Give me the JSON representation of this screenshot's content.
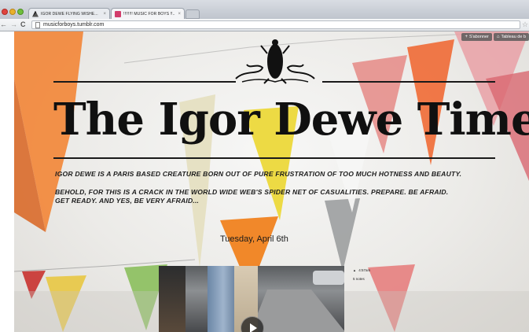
{
  "browser": {
    "tabs": [
      {
        "title": "IGOR DEWE FLYING WISHE...",
        "favicon": "igor-dewe-favicon",
        "active": false
      },
      {
        "title": "!!!!!!!! MUSIC FOR BOYS !!...",
        "favicon": "music-favicon",
        "active": true
      }
    ],
    "close_glyph": "×",
    "nav": {
      "back": "←",
      "forward": "→",
      "reload": "C"
    },
    "url": "musicforboys.tumblr.com"
  },
  "tumblr_bar": {
    "follow_label": "S'abonner",
    "dashboard_label": "Tableau de b"
  },
  "blog": {
    "title": "The Igor Dewe Times",
    "tagline_1": "IGOR DEWE IS A PARIS BASED CREATURE BORN OUT OF PURE FRUSTRATION OF TOO MUCH HOTNESS AND BEAUTY.",
    "tagline_2": "BEHOLD, FOR THIS IS A CRACK IN THE WORLD WIDE WEB'S SPIDER NET OF CASUALITIES. PREPARE. BE AFRAID.",
    "tagline_3": "GET READY. AND YES, BE VERY AFRAID...",
    "post_date": "Tuesday, April 6th",
    "post_time": "4:57am",
    "post_notes": "5 notes"
  },
  "colors": {
    "masthead_ink": "#101010",
    "page_background": "#ecebe8",
    "tab_strip": "#c9ced5"
  }
}
